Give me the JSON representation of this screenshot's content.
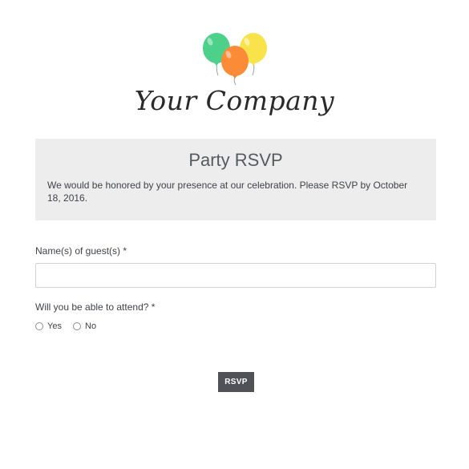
{
  "logo": {
    "icon": "balloons-icon",
    "company_name": "Your Company",
    "colors": {
      "green": "#4cd08a",
      "orange": "#fb8b37",
      "yellow": "#f8e34a"
    }
  },
  "header": {
    "title": "Party RSVP",
    "description": "We would be honored by your presence at our celebration. Please RSVP by October 18, 2016.",
    "background": "#ededee"
  },
  "form": {
    "guest_name": {
      "label": "Name(s) of guest(s) *",
      "value": "",
      "placeholder": ""
    },
    "attendance": {
      "label": "Will you be able to attend? *",
      "options": [
        {
          "label": "Yes",
          "checked": false
        },
        {
          "label": "No",
          "checked": false
        }
      ]
    },
    "submit_label": "RSVP",
    "submit_color": "#4f5358"
  }
}
